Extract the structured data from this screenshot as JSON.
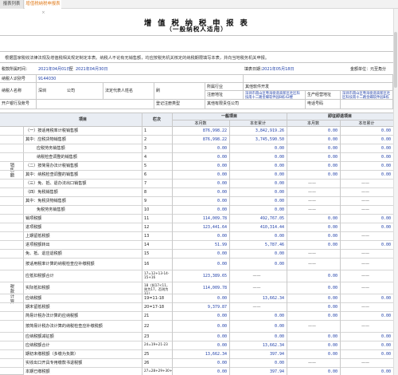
{
  "tabs": [
    {
      "label": "报表列表"
    },
    {
      "label": "增值税纳税申报表",
      "close": "×"
    }
  ],
  "title": "增 值 税 纳 税 申 报 表",
  "subtitle": "（一般纳税人适用）",
  "notice": "根据国家税收法律法规及增值税相关规定制定本表。纳税人不论有无销售额，均应按税务机关核定的纳税期限填写本表，并向当地税务机关申报。",
  "period": {
    "label": "税款所属时间：",
    "start": "2021年04月01日",
    "to": "至",
    "end": "2021年04月30日",
    "fill_label": "填表日期：",
    "fill_date": "2021年05月18日",
    "unit": "金额单位：元至角分"
  },
  "info": {
    "taxpayer_label": "纳税人识别号",
    "taxpayer_id": "9144030",
    "name_label": "纳税人名称",
    "name_value": "深圳",
    "name_suffix": "公司",
    "legal_label": "法定代表人姓名",
    "legal_value": "刷",
    "industry_label": "所属行业",
    "industry_value": "其他软件开发",
    "reg_addr_label": "注册地址",
    "reg_addr_value": "深圳市南山区粤海街道高新区社区科技南十二路金蝶软件园B栋42楼",
    "biz_addr_label": "生产经营地址",
    "biz_addr_value": "深圳市南山区粤海街道高新区社区科技南十二路金蝶软件园B栋42楼",
    "bank_label": "开户银行及账号",
    "reg_type_label": "登记注册类型",
    "reg_type_value": "其他有限责任公司",
    "phone_label": "电话号码"
  },
  "table": {
    "col_item": "项目",
    "col_line": "栏次",
    "group1": "一般项目",
    "group2": "即征即退项目",
    "sub_month": "本月数",
    "sub_year": "本年累计",
    "section1": "销售额",
    "section2": "税款计算",
    "rows": [
      {
        "item": "（一）按适用税率计税销售额",
        "line": "1",
        "v": [
          "876,998.22",
          "3,842,919.26",
          "0.00",
          "0.00"
        ]
      },
      {
        "item": "其中：应税货物销售额",
        "line": "2",
        "v": [
          "876,998.22",
          "3,745,590.50",
          "0.00",
          "0.00"
        ]
      },
      {
        "item": "应税劳务销售额",
        "line": "3",
        "v": [
          "0.00",
          "0.00",
          "0.00",
          "0.00"
        ]
      },
      {
        "item": "纳税检查调整的销售额",
        "line": "4",
        "v": [
          "0.00",
          "0.00",
          "0.00",
          "0.00"
        ]
      },
      {
        "item": "（二）按简易办法计税销售额",
        "line": "5",
        "v": [
          "0.00",
          "0.00",
          "0.00",
          "0.00"
        ]
      },
      {
        "item": "其中：纳税检查调整的销售额",
        "line": "6",
        "v": [
          "0.00",
          "0.00",
          "0.00",
          "0.00"
        ]
      },
      {
        "item": "（三）免、抵、退办法出口销售额",
        "line": "7",
        "v": [
          "0.00",
          "0.00",
          "——",
          "——"
        ]
      },
      {
        "item": "（四）免税销售额",
        "line": "8",
        "v": [
          "0.00",
          "0.00",
          "——",
          "——"
        ]
      },
      {
        "item": "其中：免税货物销售额",
        "line": "9",
        "v": [
          "0.00",
          "0.00",
          "——",
          "——"
        ]
      },
      {
        "item": "免税劳务销售额",
        "line": "10",
        "v": [
          "0.00",
          "0.00",
          "——",
          "——"
        ]
      },
      {
        "item": "销项税额",
        "line": "11",
        "v": [
          "114,009.78",
          "492,767.05",
          "0.00",
          "0.00"
        ]
      },
      {
        "item": "进项税额",
        "line": "12",
        "v": [
          "123,441.64",
          "410,314.44",
          "0.00",
          "0.00"
        ]
      },
      {
        "item": "上期留抵税额",
        "line": "13",
        "v": [
          "0.00",
          "0.00",
          "0.00",
          "——"
        ]
      },
      {
        "item": "进项税额转出",
        "line": "14",
        "v": [
          "51.99",
          "5,787.46",
          "0.00",
          "0.00"
        ]
      },
      {
        "item": "免、抵、退应退税额",
        "line": "15",
        "v": [
          "0.00",
          "0.00",
          "——",
          "——"
        ]
      },
      {
        "item": "按适用税率计算的纳税检查应补缴税额",
        "line": "16",
        "v": [
          "0.00",
          "0.00",
          "——",
          "——"
        ]
      },
      {
        "item": "应抵扣税额合计",
        "line": "17=12+13-14-15+16",
        "v": [
          "123,389.65",
          "——",
          "0.00",
          "——"
        ]
      },
      {
        "item": "实际抵扣税额",
        "line": "18（如17<11，则为17，否则为11）",
        "v": [
          "114,009.78",
          "——",
          "0.00",
          "——"
        ]
      },
      {
        "item": "应纳税额",
        "line": "19=11-18",
        "v": [
          "0.00",
          "13,662.34",
          "0.00",
          "0.00"
        ]
      },
      {
        "item": "期末留抵税额",
        "line": "20=17-18",
        "v": [
          "9,379.87",
          "——",
          "0.00",
          "——"
        ]
      },
      {
        "item": "简易计税办法计算的应纳税额",
        "line": "21",
        "v": [
          "0.00",
          "0.00",
          "0.00",
          "0.00"
        ]
      },
      {
        "item": "按简易计税办法计算的纳税检查应补缴税额",
        "line": "22",
        "v": [
          "0.00",
          "0.00",
          "——",
          "——"
        ]
      },
      {
        "item": "应纳税额减征额",
        "line": "23",
        "v": [
          "0.00",
          "0.00",
          "0.00",
          "0.00"
        ]
      },
      {
        "item": "应纳税额合计",
        "line": "24=19+21-23",
        "v": [
          "0.00",
          "13,662.34",
          "0.00",
          "0.00"
        ]
      },
      {
        "item": "期初未缴税额（多缴为负数）",
        "line": "25",
        "v": [
          "13,662.34",
          "397.94",
          "0.00",
          "0.00"
        ]
      },
      {
        "item": "实收出口开具专用缴款书退税额",
        "line": "26",
        "v": [
          "0.00",
          "0.00",
          "——",
          "——"
        ]
      },
      {
        "item": "本期已缴税额",
        "line": "27=28+29+30+31",
        "v": [
          "0.00",
          "397.94",
          "0.00",
          "0.00"
        ]
      }
    ]
  }
}
